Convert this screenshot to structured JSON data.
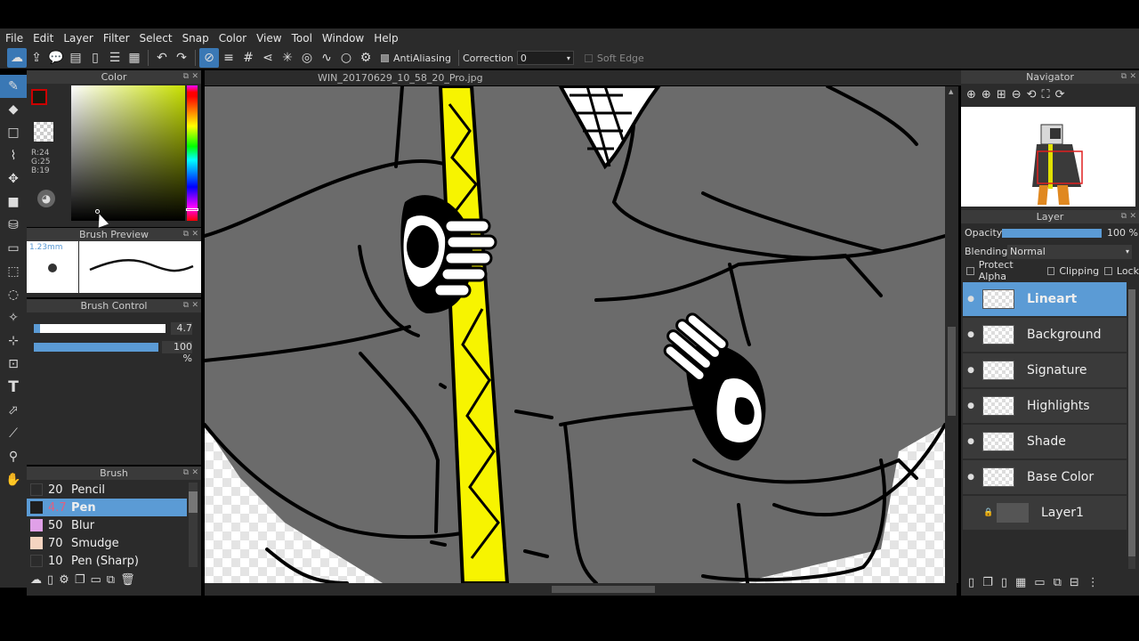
{
  "menu": [
    "File",
    "Edit",
    "Layer",
    "Filter",
    "Select",
    "Snap",
    "Color",
    "View",
    "Tool",
    "Window",
    "Help"
  ],
  "toolbar": {
    "antialiasing_label": "AntiAliasing",
    "correction_label": "Correction",
    "correction_value": "0",
    "soft_edge_label": "Soft Edge"
  },
  "document": {
    "title": "WIN_20170629_10_58_20_Pro.jpg"
  },
  "color_panel": {
    "title": "Color",
    "r": "R:24",
    "g": "G:25",
    "b": "B:19",
    "fg": "#18190f",
    "bg": "#ffffff",
    "accent": "#c8e000"
  },
  "brush_preview": {
    "title": "Brush Preview",
    "size": "1.23mm"
  },
  "brush_control": {
    "title": "Brush Control",
    "size_value": "4.7",
    "opacity_value": "100 %",
    "opacity_level": 1.0,
    "size_level": 0.05
  },
  "brush_panel": {
    "title": "Brush",
    "items": [
      {
        "size": "20",
        "name": "Pencil",
        "color": "#2b2b2b"
      },
      {
        "size": "4.7",
        "name": "Pen",
        "color": "#1f1f1f"
      },
      {
        "size": "50",
        "name": "Blur",
        "color": "#e0a0e8"
      },
      {
        "size": "70",
        "name": "Smudge",
        "color": "#f4d4c0"
      },
      {
        "size": "10",
        "name": "Pen (Sharp)",
        "color": "#2b2b2b"
      }
    ]
  },
  "navigator": {
    "title": "Navigator"
  },
  "layer_panel": {
    "title": "Layer",
    "opacity_label": "Opacity",
    "opacity_value": "100 %",
    "blending_label": "Blending",
    "blending_value": "Normal",
    "protect_alpha": "Protect Alpha",
    "clipping": "Clipping",
    "lock": "Lock",
    "layers": [
      {
        "name": "Lineart"
      },
      {
        "name": "Background"
      },
      {
        "name": "Signature"
      },
      {
        "name": "Highlights"
      },
      {
        "name": "Shade"
      },
      {
        "name": "Base Color"
      },
      {
        "name": "Layer1"
      }
    ]
  }
}
